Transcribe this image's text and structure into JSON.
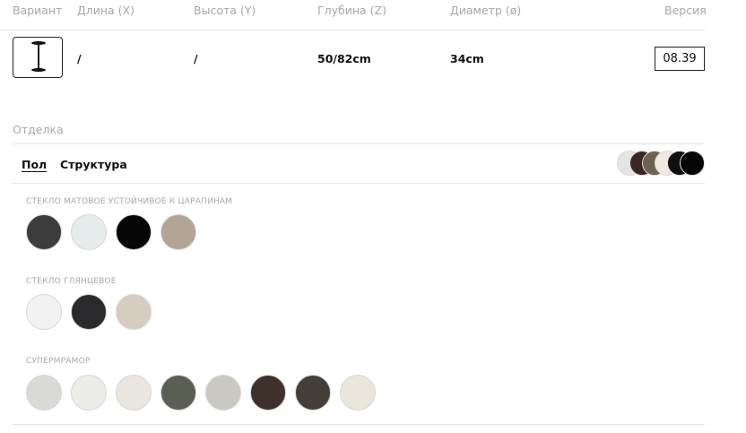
{
  "headers": {
    "variant": "Вариант",
    "length": "Длина (X)",
    "height": "Высота (Y)",
    "depth": "Глубина (Z)",
    "diameter": "Диаметр (ø)",
    "version": "Версия"
  },
  "row": {
    "length": "/",
    "height": "/",
    "depth": "50/82cm",
    "diameter": "34cm",
    "version": "08.39"
  },
  "finish": {
    "title": "Отделка",
    "tabs": [
      {
        "label": "Пол",
        "active": true
      },
      {
        "label": "Структура",
        "active": false
      }
    ],
    "preview_colors": [
      "#e4e4e1",
      "#3b2624",
      "#6b6350",
      "#eeeae2",
      "#101010",
      "#050505"
    ],
    "groups": [
      {
        "label": "СТЕКЛО МАТОВОЕ УСТОЙЧИВОЕ К ЦАРАПИНАМ",
        "swatches": [
          {
            "name": "graphite",
            "color": "#3c3c3c"
          },
          {
            "name": "ice-white",
            "color": "#e6eceb"
          },
          {
            "name": "black",
            "color": "#060606"
          },
          {
            "name": "taupe",
            "color": "#b2a597"
          }
        ]
      },
      {
        "label": "СТЕКЛО ГЛЯНЦЕВОЕ",
        "swatches": [
          {
            "name": "white-gloss",
            "color": "#f2f2f2"
          },
          {
            "name": "black-gloss",
            "color": "#2a2a2c"
          },
          {
            "name": "champagne",
            "color": "#d6ccc0"
          }
        ]
      },
      {
        "label": "СУПЕРМРАМОР",
        "swatches": [
          {
            "name": "marble-grey-white",
            "color": "#d9d9d6"
          },
          {
            "name": "marble-white",
            "color": "#ecece9"
          },
          {
            "name": "marble-calacatta",
            "color": "#e8e6df"
          },
          {
            "name": "marble-green",
            "color": "#5b5e52"
          },
          {
            "name": "marble-breccia",
            "color": "#c9c8c2"
          },
          {
            "name": "marble-brown",
            "color": "#3e302b"
          },
          {
            "name": "marble-dark",
            "color": "#443d38"
          },
          {
            "name": "marble-cream",
            "color": "#eae6dc"
          }
        ]
      }
    ]
  }
}
